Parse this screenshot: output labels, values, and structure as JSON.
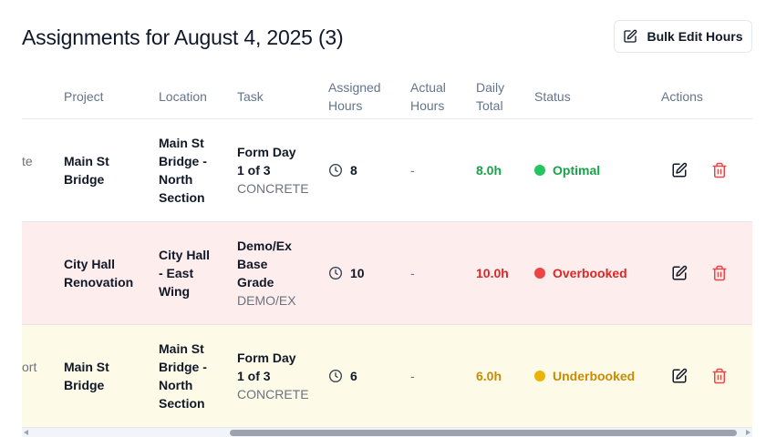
{
  "header": {
    "title": "Assignments for August 4, 2025 (3)",
    "bulk_edit_label": "Bulk Edit Hours"
  },
  "columns": {
    "project": "Project",
    "location": "Location",
    "task": "Task",
    "assigned_1": "Assigned",
    "assigned_2": "Hours",
    "actual_1": "Actual",
    "actual_2": "Hours",
    "daily_1": "Daily",
    "daily_2": "Total",
    "status": "Status",
    "actions": "Actions"
  },
  "rows": [
    {
      "cut_text": "te",
      "project": [
        "Main St",
        "Bridge"
      ],
      "location": [
        "Main St",
        "Bridge -",
        "North",
        "Section"
      ],
      "task": [
        "Form Day",
        "1 of 3"
      ],
      "task_code": "CONCRETE",
      "assigned": "8",
      "actual": "-",
      "daily_total": "8.0h",
      "status": "Optimal",
      "status_color": "#16a34a",
      "dot_color": "#22c55e"
    },
    {
      "cut_text": "",
      "project": [
        "City Hall",
        "Renovation"
      ],
      "location": [
        "City Hall",
        "- East",
        "Wing"
      ],
      "task": [
        "Demo/Ex",
        "Base",
        "Grade"
      ],
      "task_code": "DEMO/EX",
      "assigned": "10",
      "actual": "-",
      "daily_total": "10.0h",
      "status": "Overbooked",
      "status_color": "#dc2626",
      "dot_color": "#ef4444"
    },
    {
      "cut_text": "ort",
      "project": [
        "Main St",
        "Bridge"
      ],
      "location": [
        "Main St",
        "Bridge -",
        "North",
        "Section"
      ],
      "task": [
        "Form Day",
        "1 of 3"
      ],
      "task_code": "CONCRETE",
      "assigned": "6",
      "actual": "-",
      "daily_total": "6.0h",
      "status": "Underbooked",
      "status_color": "#ca8a04",
      "dot_color": "#eab308"
    }
  ]
}
